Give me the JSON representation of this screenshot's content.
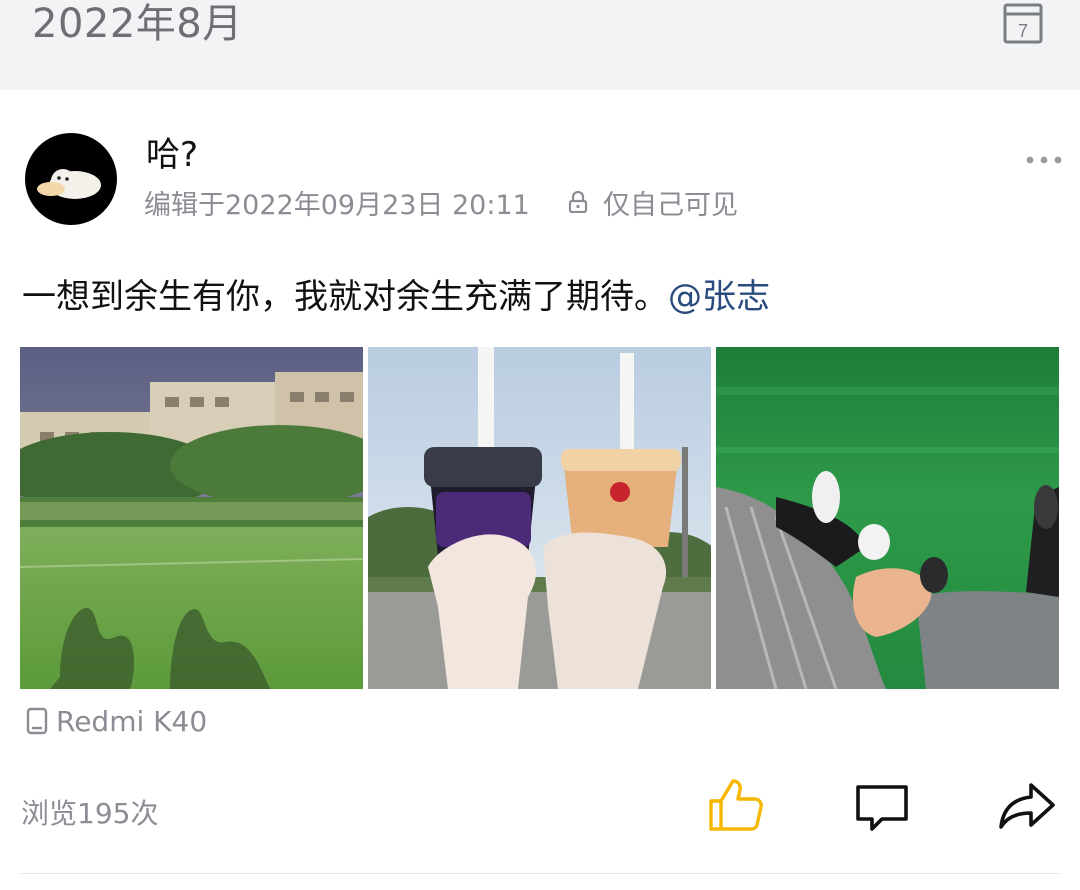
{
  "header": {
    "month_title": "2022年8月",
    "calendar_day": "7"
  },
  "post": {
    "username": "哈?",
    "edited_time": "编辑于2022年09月23日 20:11",
    "visibility": "仅自己可见",
    "text": "一想到余生有你，我就对余生充满了期待。",
    "mention": "@张志",
    "photos": [
      {
        "name": "playground-night-shadows"
      },
      {
        "name": "two-milk-tea-cups"
      },
      {
        "name": "holding-hands-green-floor"
      }
    ],
    "device": "Redmi K40",
    "views": "浏览195次"
  },
  "icons": {
    "calendar": "calendar-icon",
    "lock": "lock-icon",
    "more": "more-icon",
    "device": "phone-icon",
    "like": "thumbs-up-icon",
    "comment": "comment-icon",
    "share": "share-icon"
  },
  "colors": {
    "header_bg": "#f2f3f5",
    "like_accent": "#f5b700",
    "mention": "#2a4b7d",
    "muted_text": "#8a8d93"
  }
}
